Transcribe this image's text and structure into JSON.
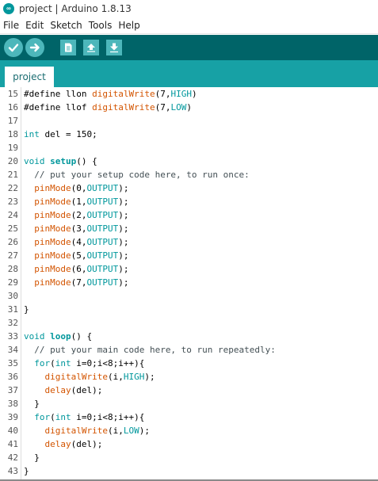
{
  "window": {
    "title": "project | Arduino 1.8.13",
    "logo_glyph": "∞"
  },
  "menu": [
    "File",
    "Edit",
    "Sketch",
    "Tools",
    "Help"
  ],
  "toolbar": {
    "buttons": [
      {
        "name": "verify-button",
        "icon": "check-icon"
      },
      {
        "name": "upload-button",
        "icon": "arrow-right-icon"
      },
      {
        "name": "new-button",
        "icon": "document-icon"
      },
      {
        "name": "open-button",
        "icon": "arrow-up-icon"
      },
      {
        "name": "save-button",
        "icon": "arrow-down-icon"
      }
    ]
  },
  "tabs": [
    {
      "label": "project"
    }
  ],
  "colors": {
    "toolbar_bg": "#006468",
    "tabbar_bg": "#17a1a5",
    "button_bg": "#4db7bb",
    "keyword": "#00979c",
    "function": "#d35400",
    "comment": "#434f54"
  },
  "editor": {
    "lines": [
      {
        "n": "15",
        "code": "#define llon digitalWrite(7,HIGH)"
      },
      {
        "n": "16",
        "code": "#define llof digitalWrite(7,LOW)"
      },
      {
        "n": "17",
        "code": ""
      },
      {
        "n": "18",
        "code": "int del = 150;"
      },
      {
        "n": "19",
        "code": ""
      },
      {
        "n": "20",
        "code": "void setup() {"
      },
      {
        "n": "21",
        "code": "  // put your setup code here, to run once:"
      },
      {
        "n": "22",
        "code": "  pinMode(0,OUTPUT);"
      },
      {
        "n": "23",
        "code": "  pinMode(1,OUTPUT);"
      },
      {
        "n": "24",
        "code": "  pinMode(2,OUTPUT);"
      },
      {
        "n": "25",
        "code": "  pinMode(3,OUTPUT);"
      },
      {
        "n": "26",
        "code": "  pinMode(4,OUTPUT);"
      },
      {
        "n": "27",
        "code": "  pinMode(5,OUTPUT);"
      },
      {
        "n": "28",
        "code": "  pinMode(6,OUTPUT);"
      },
      {
        "n": "29",
        "code": "  pinMode(7,OUTPUT);"
      },
      {
        "n": "30",
        "code": ""
      },
      {
        "n": "31",
        "code": "}"
      },
      {
        "n": "32",
        "code": ""
      },
      {
        "n": "33",
        "code": "void loop() {"
      },
      {
        "n": "34",
        "code": "  // put your main code here, to run repeatedly:"
      },
      {
        "n": "35",
        "code": "  for(int i=0;i<8;i++){"
      },
      {
        "n": "36",
        "code": "    digitalWrite(i,HIGH);"
      },
      {
        "n": "37",
        "code": "    delay(del);"
      },
      {
        "n": "38",
        "code": "  }"
      },
      {
        "n": "39",
        "code": "  for(int i=0;i<8;i++){"
      },
      {
        "n": "40",
        "code": "    digitalWrite(i,LOW);"
      },
      {
        "n": "41",
        "code": "    delay(del);"
      },
      {
        "n": "42",
        "code": "  }"
      },
      {
        "n": "43",
        "code": "}"
      }
    ]
  }
}
